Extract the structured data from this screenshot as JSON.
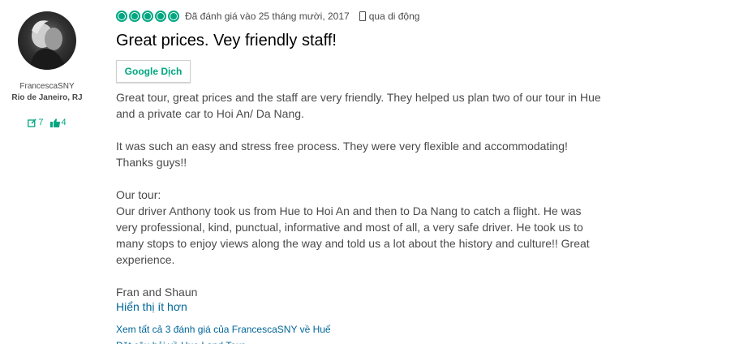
{
  "reviewer": {
    "username": "FrancescaSNY",
    "location": "Rio de Janeiro, RJ",
    "reviews_count": "7",
    "helpful_votes": "4"
  },
  "review": {
    "rating": 5,
    "date_text": "Đã đánh giá vào 25 tháng mười, 2017",
    "via_text": "qua di động",
    "title": "Great prices. Vey friendly staff!",
    "translate_label": "Google Dịch",
    "paragraphs": [
      "Great tour, great prices and the staff are very friendly. They helped us plan two of our tour in Hue and a private car to Hoi An/ Da Nang.",
      "It was such an easy and stress free process. They were very flexible and accommodating! Thanks guys!!",
      "Our tour:",
      "Our driver Anthony took us from Hue to Hoi An and then to Da Nang to catch a flight. He was very professional, kind, punctual, informative and most of all, a very safe driver. He took us to many stops to enjoy views along the way and told us a lot about the history and culture!! Great experience.",
      "Fran and Shaun"
    ],
    "show_less": "Hiển thị ít hơn",
    "see_all": "Xem tất cả 3 đánh giá của FrancescaSNY về Huế",
    "cut_link": "Đặt câu hỏi về Hue Land Tour"
  },
  "colors": {
    "accent": "#00a680",
    "link": "#006699",
    "text": "#4a4a4a"
  }
}
